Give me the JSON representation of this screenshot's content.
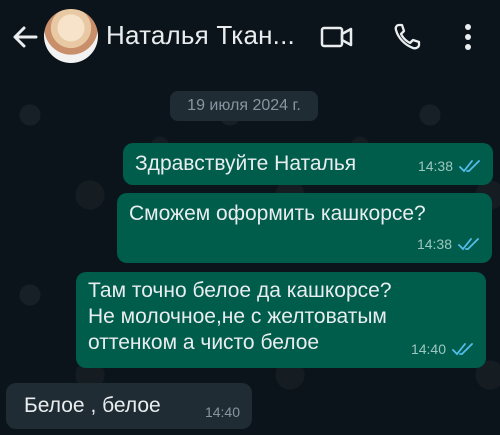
{
  "header": {
    "contact_name": "Наталья Ткан..."
  },
  "chat": {
    "date_chip": "19 июля 2024 г.",
    "messages": [
      {
        "direction": "out",
        "text": "Здравствуйте Наталья",
        "time": "14:38",
        "status": "read"
      },
      {
        "direction": "out",
        "text": "Сможем оформить кашкорсе?",
        "time": "14:38",
        "status": "read"
      },
      {
        "direction": "out",
        "text": "Там точно белое да кашкорсе?\nНе молочное,не с желтоватым\nоттенком а чисто белое",
        "time": "14:40",
        "status": "read"
      },
      {
        "direction": "in",
        "text": "Белое , белое",
        "time": "14:40"
      }
    ]
  },
  "colors": {
    "background": "#0b141a",
    "outgoing_bubble": "#005c4b",
    "incoming_bubble": "#1f2c34",
    "read_tick": "#53bdeb"
  },
  "icons": [
    "back-arrow-icon",
    "video-call-icon",
    "phone-icon",
    "more-vert-icon",
    "double-check-icon"
  ]
}
